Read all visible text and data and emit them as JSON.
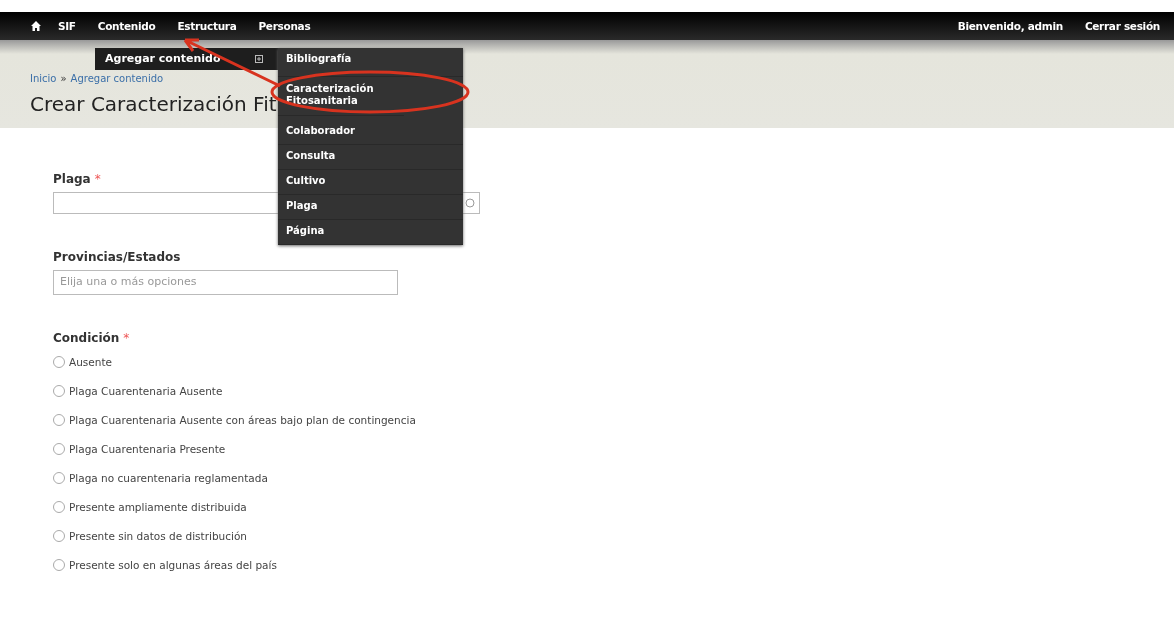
{
  "toolbar": {
    "items": [
      {
        "label": "SIF"
      },
      {
        "label": "Contenido"
      },
      {
        "label": "Estructura"
      },
      {
        "label": "Personas"
      }
    ],
    "user": "Bienvenido, admin",
    "logout": "Cerrar sesión"
  },
  "submenu": {
    "label": "Agregar contenido",
    "items": [
      "Bibliografía",
      "Caracterización Fitosanitaria",
      "Colaborador",
      "Consulta",
      "Cultivo",
      "Plaga",
      "Página"
    ]
  },
  "breadcrumb": {
    "items": [
      "Inicio",
      "Agregar contenido"
    ],
    "separator": "»"
  },
  "page_title": "Crear Caracterización Fit",
  "fields": [
    {
      "label": "Plaga",
      "required_mark": "*",
      "kind": "autocomplete"
    },
    {
      "label": "Provincias/Estados",
      "kind": "select",
      "placeholder": "Elija una o más opciones"
    }
  ],
  "condition": {
    "label": "Condición",
    "required_mark": "*",
    "options": [
      {
        "label": "Ausente",
        "selected": false
      },
      {
        "label": "Plaga Cuarentenaria Ausente",
        "selected": false
      },
      {
        "label": "Plaga Cuarentenaria Ausente con áreas bajo plan de contingencia",
        "selected": false
      },
      {
        "label": "Plaga Cuarentenaria Presente",
        "selected": false
      },
      {
        "label": "Plaga no cuarentenaria reglamentada",
        "selected": false
      },
      {
        "label": "Presente ampliamente distribuida",
        "selected": false
      },
      {
        "label": "Presente sin datos de distribución",
        "selected": false
      },
      {
        "label": "Presente solo en algunas áreas del país",
        "selected": false
      }
    ]
  }
}
